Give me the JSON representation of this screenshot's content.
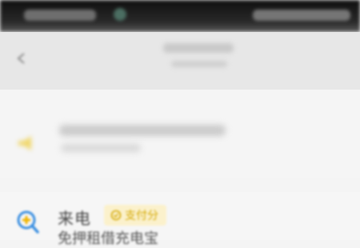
{
  "colors": {
    "status_bar": "#1a1a1a",
    "nav_bar": "#e7e7e7",
    "page_background": "#f4f4f4",
    "badge_background": "#fbf1cc",
    "badge_text": "#d4a800",
    "service_icon": "#3b8fe0"
  },
  "icons": {
    "back": "back-arrow-icon",
    "banner": "megaphone-icon",
    "service": "search-plus-icon",
    "badge": "payment-score-icon"
  },
  "service": {
    "name": "来电",
    "badge": "支付分",
    "description": "免押租借充电宝"
  }
}
